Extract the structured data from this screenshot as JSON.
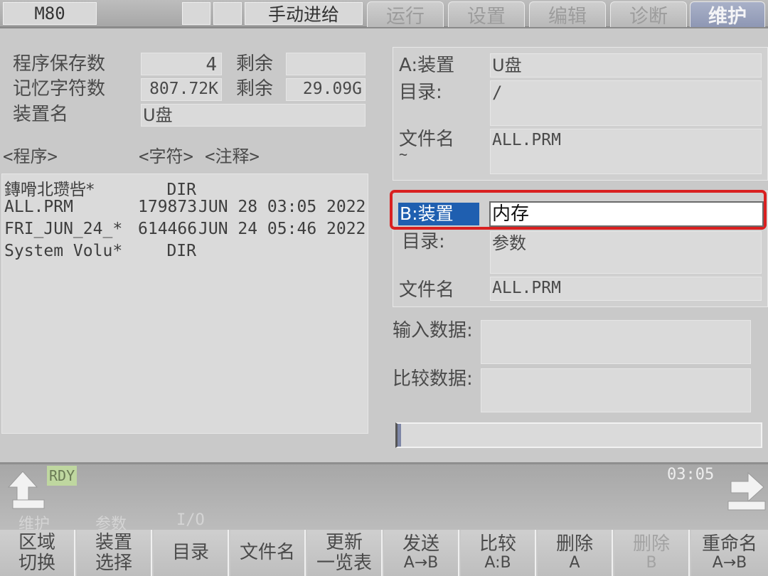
{
  "topbar": {
    "model": "M80",
    "mode": "手动进给",
    "tabs": [
      {
        "label": "运行",
        "active": false
      },
      {
        "label": "设置",
        "active": false
      },
      {
        "label": "编辑",
        "active": false
      },
      {
        "label": "诊断",
        "active": false
      },
      {
        "label": "维护",
        "active": true
      }
    ]
  },
  "left": {
    "program_count_label": "程序保存数",
    "program_count_value": "4",
    "remain_label": "剩余",
    "remain1_value": "",
    "memory_label": "记忆字符数",
    "memory_value": "807.72K",
    "remain2_value": "29.09G",
    "device_label": "装置名",
    "device_value": "U盘",
    "columns": {
      "program": "<程序>",
      "chars": "<字符>",
      "comment": "<注释>"
    },
    "files": [
      {
        "name": "鏄嗗北瓒呰*",
        "size": "DIR",
        "date": ""
      },
      {
        "name": "ALL.PRM",
        "size": "179873",
        "date": "JUN 28 03:05 2022"
      },
      {
        "name": "FRI_JUN_24_*",
        "size": "614466",
        "date": "JUN 24 05:46 2022"
      },
      {
        "name": "System Volu*",
        "size": "DIR",
        "date": ""
      }
    ]
  },
  "a_section": {
    "device_label": "A:装置",
    "device_value": "U盘",
    "dir_label": "目录:",
    "dir_value": "/",
    "file_label": "文件名",
    "file_value": "ALL.PRM",
    "tilde": "~"
  },
  "b_section": {
    "device_label": "B:装置",
    "device_value": "内存",
    "dir_label": "目录:",
    "dir_value": "参数",
    "file_label": "文件名",
    "file_value": "ALL.PRM"
  },
  "input_data_label": "输入数据:",
  "compare_data_label": "比较数据:",
  "progress": 0.01,
  "status": {
    "rdy": "RDY",
    "time": "03:05",
    "menu_path": [
      "维护",
      "参数",
      "I/O"
    ]
  },
  "fkeys": [
    {
      "l1": "区域",
      "l2": "切换",
      "dim": false
    },
    {
      "l1": "装置",
      "l2": "选择",
      "dim": false
    },
    {
      "l1": "目录",
      "l2": "",
      "dim": false
    },
    {
      "l1": "文件名",
      "l2": "",
      "dim": false
    },
    {
      "l1": "更新",
      "l2": "一览表",
      "dim": false
    },
    {
      "l1": "发送",
      "l2": "A→B",
      "dim": false
    },
    {
      "l1": "比较",
      "l2": "A:B",
      "dim": false
    },
    {
      "l1": "删除",
      "l2": "A",
      "dim": false
    },
    {
      "l1": "删除",
      "l2": "B",
      "dim": true
    },
    {
      "l1": "重命名",
      "l2": "A→B",
      "dim": false
    }
  ],
  "colors": {
    "highlight": "#1f5fb0",
    "selection_border": "#d92020",
    "active_tab": "#8e97b4",
    "rdy_bg": "#bfd7a0"
  }
}
